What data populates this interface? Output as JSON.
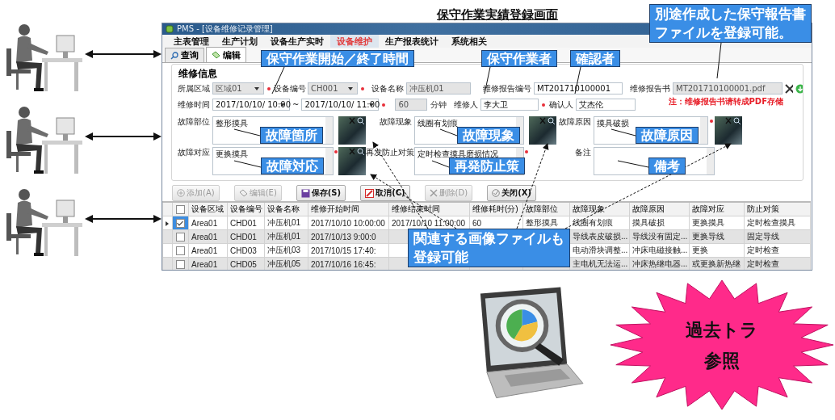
{
  "title": "保守作業実績登録画面",
  "window": {
    "title": "PMS - [设备维修记录管理]",
    "menu": [
      {
        "label": "主表管理",
        "selected": false
      },
      {
        "label": "生产计划",
        "selected": false
      },
      {
        "label": "设备生产实时",
        "selected": false
      },
      {
        "label": "设备维护",
        "selected": true
      },
      {
        "label": "生产报表统计",
        "selected": false
      },
      {
        "label": "系统相关",
        "selected": false
      }
    ],
    "tabs": [
      {
        "label": "查询",
        "kind": "search",
        "selected": false
      },
      {
        "label": "编辑",
        "kind": "edit",
        "selected": true
      }
    ],
    "group_title": "维修信息",
    "form": {
      "area": {
        "label": "所属区域",
        "value": "区域01",
        "disabled": true,
        "required": true
      },
      "equipment_no": {
        "label": "设备编号",
        "value": "CH001",
        "disabled": true,
        "required": true
      },
      "equipment_name": {
        "label": "设备名称",
        "value": "冲压机01",
        "disabled": true
      },
      "report_no": {
        "label": "维修报告编号",
        "value": "MT201710100001"
      },
      "report_file": {
        "label": "维修报告书",
        "value": "MT201710100001.pdf",
        "disabled": true
      },
      "report_note": "注：维修报告书请转成PDF存储",
      "time": {
        "label": "维修时间",
        "start": "2017/10/10/ 10:00",
        "separator": "~",
        "end": "2017/10/10/ 11:00",
        "required": true
      },
      "duration": {
        "value": "60",
        "unit": "分钟",
        "disabled": true
      },
      "worker": {
        "label": "维修人",
        "value": "李大卫",
        "required": true
      },
      "confirmer": {
        "label": "确认人",
        "value": "艾杰伦"
      },
      "fault_part": {
        "label": "故障部位",
        "value": "整形摸具",
        "photo": true,
        "required": false
      },
      "fault_symptom": {
        "label": "故障现象",
        "value": "线圈有划痕",
        "photo": true,
        "required": false
      },
      "fault_cause": {
        "label": "故障原因",
        "value": "摸具破损",
        "photo": true,
        "required": true
      },
      "fault_action": {
        "label": "故障对应",
        "value": "更换摸具",
        "photo": true,
        "required": true
      },
      "prevention": {
        "label": "再发防止对策",
        "value": "定时检查摸具磨损情况",
        "required": true
      },
      "remarks": {
        "label": "备注"
      }
    },
    "buttons": [
      {
        "label": "添加(A)",
        "kind": "add",
        "disabled": true
      },
      {
        "label": "编辑(E)",
        "kind": "edit",
        "disabled": true
      },
      {
        "label": "保存(S)",
        "kind": "save",
        "disabled": false
      },
      {
        "label": "取消(C)",
        "kind": "cancel",
        "disabled": false
      },
      {
        "label": "删除(D)",
        "kind": "delete",
        "disabled": true
      },
      {
        "label": "关闭(X)",
        "kind": "close",
        "disabled": false
      }
    ],
    "table": {
      "header_checked": false,
      "columns": [
        "设备区域",
        "设备编号",
        "设备名称",
        "维修开始时间",
        "维修结束时间",
        "维修耗时(分)",
        "故障部位",
        "故障现象",
        "故障原因",
        "故障对应",
        "防止对策"
      ],
      "rows": [
        {
          "current": true,
          "selected": true,
          "checked": true,
          "cells": [
            "Area01",
            "CHD01",
            "冲压机01",
            "2017/10/10 10:00:00",
            "2017/10/10 11:00:00",
            "60",
            "整形摸具",
            "线圈有划痕",
            "摸具破损",
            "更换摸具",
            "定时检查摸具"
          ]
        },
        {
          "current": false,
          "selected": false,
          "checked": false,
          "cells": [
            "Area01",
            "CHD01",
            "冲压机01",
            "2017/10/13 9:00:0",
            null,
            null,
            null,
            "导线表皮破损...",
            "导线没有固定...",
            "更换导线",
            "固定导线"
          ]
        },
        {
          "current": false,
          "selected": false,
          "checked": false,
          "cells": [
            "Area01",
            "CHD03",
            "冲压机03",
            "2017/10/15 17:40:",
            null,
            null,
            null,
            "电动滑块调整...",
            "冲床电磁接触...",
            "更换",
            "定时检查"
          ]
        },
        {
          "current": false,
          "selected": false,
          "checked": false,
          "cells": [
            "Area01",
            "CHD05",
            "冲压机05",
            "2017/10/16 16:45:",
            null,
            null,
            null,
            "主电机无法运...",
            "冲床热继电器...",
            "或更换新热继",
            "定时检查"
          ]
        }
      ]
    }
  },
  "callouts": [
    {
      "lines": [
        "保守作業開始／終了時間"
      ]
    },
    {
      "lines": [
        "保守作業者"
      ]
    },
    {
      "lines": [
        "確認者"
      ]
    },
    {
      "lines": [
        "別途作成した保守報告書",
        "ファイルを登録可能。"
      ]
    },
    {
      "lines": [
        "故障箇所"
      ]
    },
    {
      "lines": [
        "故障現象"
      ]
    },
    {
      "lines": [
        "故障原因"
      ]
    },
    {
      "lines": [
        "故障対応"
      ]
    },
    {
      "lines": [
        "再発防止策"
      ]
    },
    {
      "lines": [
        "備考"
      ]
    },
    {
      "lines": [
        "関連する画像ファイルも",
        "登録可能"
      ]
    }
  ],
  "starburst": {
    "lines": [
      "過去トラ",
      "参照"
    ]
  }
}
